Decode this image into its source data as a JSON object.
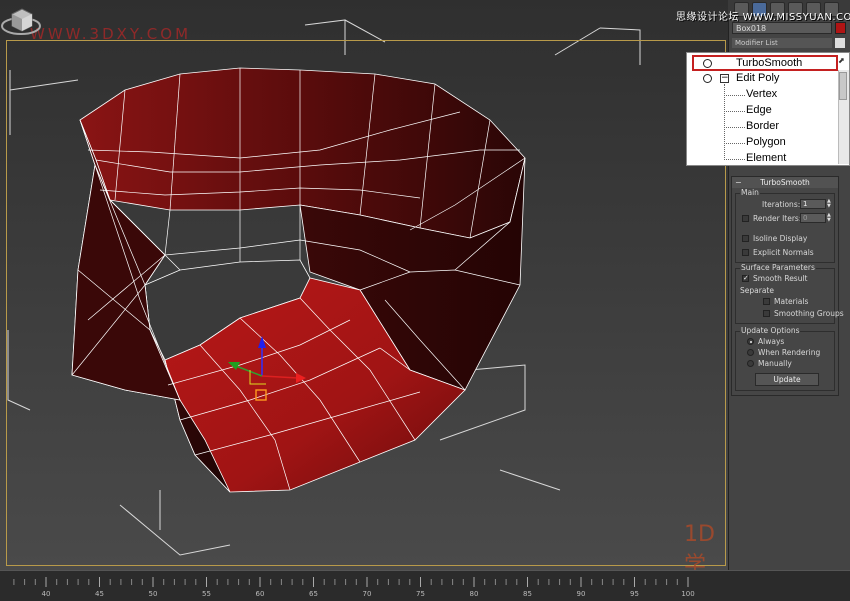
{
  "watermarks": {
    "top_left": "WWW.3DXY.COM",
    "top_right": "思缘设计论坛 WWW.MISSYUAN.COM",
    "bottom_right": "1D学"
  },
  "colors": {
    "accent_red": "#c42020",
    "mesh_red": "#a81616",
    "object_color": "#b01414"
  },
  "command_panel": {
    "object_name": "Box018",
    "modifier_list_label": "Modifier List",
    "stack": [
      {
        "label": "TurboSmooth",
        "level": 0,
        "icon": "bulb-icon",
        "selected": true
      },
      {
        "label": "Edit Poly",
        "level": 0,
        "icon": "bulb-icon",
        "expanded": true
      },
      {
        "label": "Vertex",
        "level": 1
      },
      {
        "label": "Edge",
        "level": 1
      },
      {
        "label": "Border",
        "level": 1
      },
      {
        "label": "Polygon",
        "level": 1
      },
      {
        "label": "Element",
        "level": 1
      }
    ],
    "turbosmooth": {
      "title": "TurboSmooth",
      "main_group": "Main",
      "iterations_label": "Iterations:",
      "iterations_value": "1",
      "render_iters_label": "Render Iters:",
      "render_iters_value": "0",
      "render_iters_checked": false,
      "isoline_display": "Isoline Display",
      "isoline_checked": false,
      "explicit_normals": "Explicit Normals",
      "explicit_checked": false,
      "surface_group": "Surface Parameters",
      "smooth_result": "Smooth Result",
      "smooth_result_checked": true,
      "separate_label": "Separate",
      "materials": "Materials",
      "materials_checked": false,
      "smoothing_groups": "Smoothing Groups",
      "smoothing_checked": false,
      "update_group": "Update Options",
      "opt_always": "Always",
      "opt_rendering": "When Rendering",
      "opt_manually": "Manually",
      "selected_option": "Always",
      "update_button": "Update"
    }
  },
  "timeline": {
    "ticks": [
      "40",
      "45",
      "50",
      "55",
      "60",
      "65",
      "70",
      "75",
      "80",
      "85",
      "90",
      "95",
      "100"
    ]
  },
  "icons": [
    "bulb-icon",
    "expand-minus-icon",
    "pin-icon",
    "viewcube-icon",
    "move-gizmo-icon"
  ]
}
